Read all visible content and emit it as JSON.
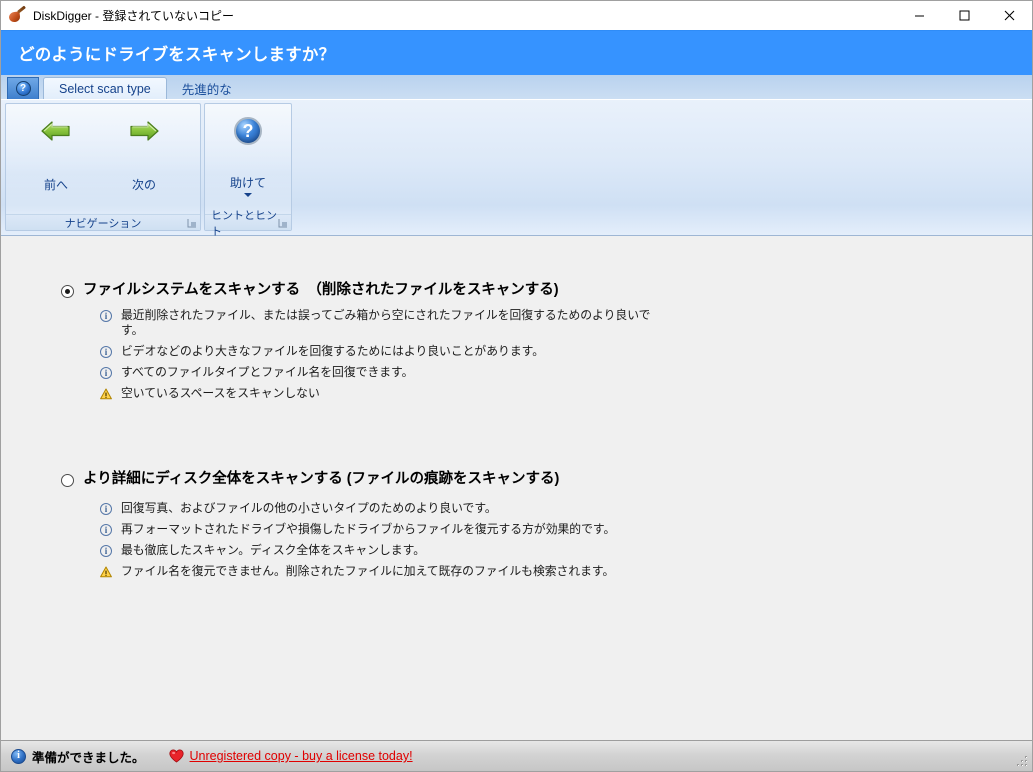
{
  "window": {
    "title": "DiskDigger - 登録されていないコピー",
    "icon": "shovel-icon",
    "controls": {
      "minimize": "minimize-icon",
      "maximize": "maximize-icon",
      "close": "close-icon"
    }
  },
  "header": {
    "title": "どのようにドライブをスキャンしますか？",
    "accent_color": "#3693ff"
  },
  "ribbon": {
    "help_tab_glyph": "?",
    "tabs": [
      {
        "label": "Select scan type",
        "active": true
      },
      {
        "label": "先進的な",
        "active": false
      }
    ],
    "groups": [
      {
        "name": "navigation",
        "title": "ナビゲーション",
        "buttons": [
          {
            "name": "previous",
            "label": "前へ",
            "icon": "arrow-left-icon"
          },
          {
            "name": "next",
            "label": "次の",
            "icon": "arrow-right-icon"
          }
        ]
      },
      {
        "name": "hints-and-tips",
        "title": "ヒントとヒント",
        "buttons": [
          {
            "name": "help",
            "label": "助けて",
            "icon": "help-icon",
            "has_dropdown": true
          }
        ]
      }
    ]
  },
  "main": {
    "options": [
      {
        "id": "scan-file-system",
        "selected": true,
        "title": "ファイルシステムをスキャンする　（削除されたファイルをスキャンする)",
        "bullets": [
          {
            "icon": "info-icon",
            "text": "最近削除されたファイル、または誤ってごみ箱から空にされたファイルを回復するためのより良いです。"
          },
          {
            "icon": "info-icon",
            "text": "ビデオなどのより大きなファイルを回復するためにはより良いことがあります。"
          },
          {
            "icon": "info-icon",
            "text": "すべてのファイルタイプとファイル名を回復できます。"
          },
          {
            "icon": "warning-icon",
            "text": "空いているスペースをスキャンしない"
          }
        ]
      },
      {
        "id": "scan-whole-disk",
        "selected": false,
        "title": "より詳細にディスク全体をスキャンする (ファイルの痕跡をスキャンする)",
        "bullets": [
          {
            "icon": "info-icon",
            "text": "回復写真、およびファイルの他の小さいタイプのためのより良いです。"
          },
          {
            "icon": "info-icon",
            "text": "再フォーマットされたドライブや損傷したドライブからファイルを復元する方が効果的です。"
          },
          {
            "icon": "info-icon",
            "text": "最も徹底したスキャン。ディスク全体をスキャンします。"
          },
          {
            "icon": "warning-icon",
            "text": "ファイル名を復元できません。削除されたファイルに加えて既存のファイルも検索されます。"
          }
        ]
      }
    ]
  },
  "statusbar": {
    "info_icon": "info-icon",
    "status_text": "準備ができました。",
    "heart_icon": "heart-icon",
    "link_text": "Unregistered copy - buy a license today!",
    "link_color": "#e00000",
    "grip": "resize-grip-icon"
  }
}
